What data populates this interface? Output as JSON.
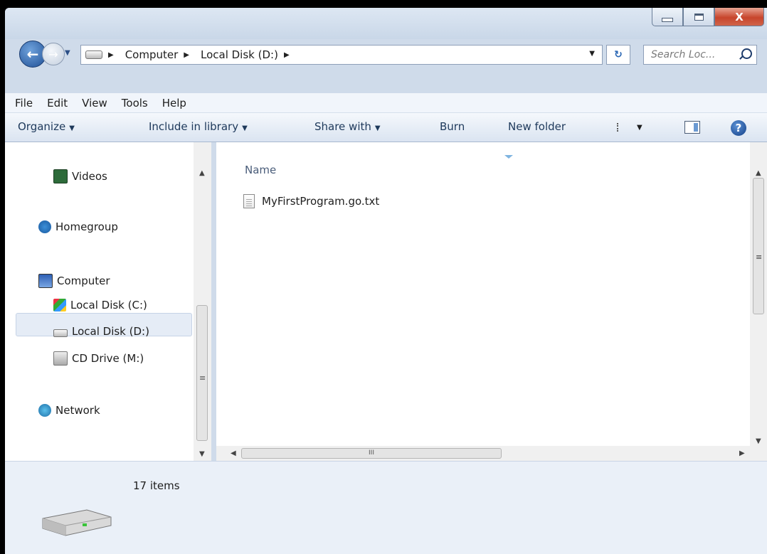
{
  "window": {
    "caption_buttons": {
      "minimize_icon": "minimize-icon",
      "maximize_icon": "maximize-icon",
      "close_label": "X"
    }
  },
  "nav": {
    "breadcrumbs": [
      "Computer",
      "Local Disk (D:)"
    ],
    "search_placeholder": "Search Loc...",
    "refresh_icon": "↻"
  },
  "menu": {
    "items": [
      "File",
      "Edit",
      "View",
      "Tools",
      "Help"
    ]
  },
  "toolbar": {
    "organize": "Organize",
    "include": "Include in library",
    "share": "Share with",
    "burn": "Burn",
    "newfolder": "New folder",
    "help_icon": "?"
  },
  "navpane": {
    "items": [
      "Videos",
      "Homegroup",
      "Computer",
      "Local Disk (C:)",
      "Local Disk (D:)",
      "CD Drive (M:)",
      "Network"
    ],
    "selected": "Local Disk (D:)"
  },
  "content": {
    "column": "Name",
    "files": [
      "MyFirstProgram.go.txt"
    ],
    "hscroll_grip": "III"
  },
  "status": {
    "count": "17 items"
  },
  "colors": {
    "accent": "#1f4f95",
    "selection": "#e5ecf6",
    "close_red": "#c7452c"
  }
}
